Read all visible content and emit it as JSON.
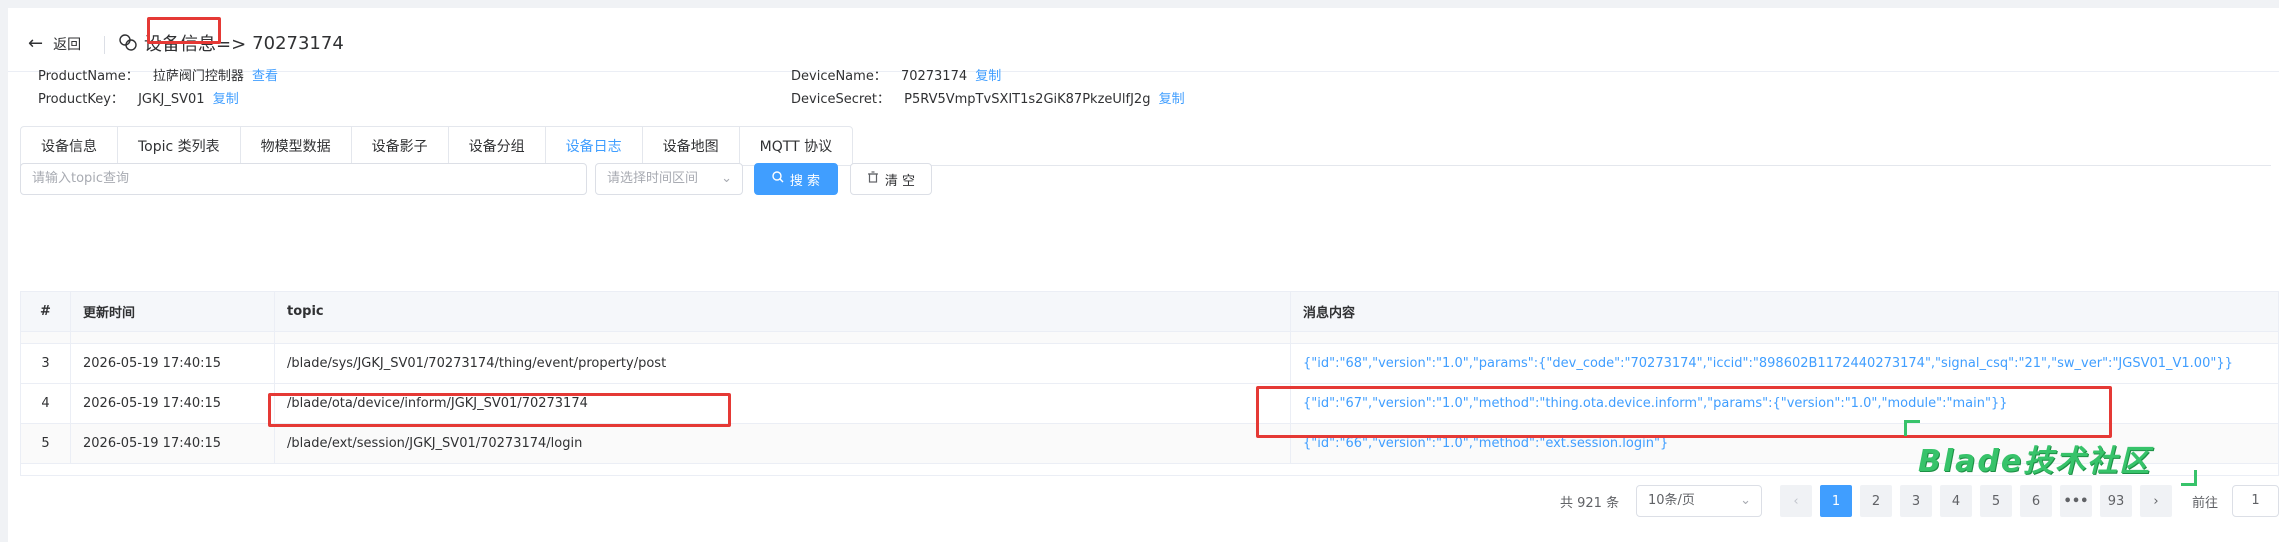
{
  "header": {
    "back_label": "返回",
    "title_prefix": "设备信息=>",
    "device_id": "70273174"
  },
  "info": {
    "product_name_key": "ProductName：",
    "product_name_value": "拉萨阀门控制器",
    "product_name_link": "查看",
    "product_key_key": "ProductKey：",
    "product_key_value": "JGKJ_SV01",
    "product_key_link": "复制",
    "device_name_key": "DeviceName：",
    "device_name_value": "70273174",
    "device_name_link": "复制",
    "device_secret_key": "DeviceSecret：",
    "device_secret_value": "P5RV5VmpTvSXIT1s2GiK87PkzeUlfJ2g",
    "device_secret_link": "复制"
  },
  "tabs": [
    {
      "label": "设备信息"
    },
    {
      "label": "Topic 类列表"
    },
    {
      "label": "物模型数据"
    },
    {
      "label": "设备影子"
    },
    {
      "label": "设备分组"
    },
    {
      "label": "设备日志",
      "active": true
    },
    {
      "label": "设备地图"
    },
    {
      "label": "MQTT 协议"
    }
  ],
  "filters": {
    "topic_placeholder": "请输入topic查询",
    "time_placeholder": "请选择时间区间",
    "search_label": "搜 索",
    "clear_label": "清 空"
  },
  "table": {
    "headers": [
      "#",
      "更新时间",
      "topic",
      "消息内容"
    ],
    "rows": [
      {
        "index": "3",
        "time": "2026-05-19 17:40:15",
        "topic": "/blade/sys/JGKJ_SV01/70273174/thing/event/property/post",
        "msg": "{\"id\":\"68\",\"version\":\"1.0\",\"params\":{\"dev_code\":\"70273174\",\"iccid\":\"898602B1172440273174\",\"signal_csq\":\"21\",\"sw_ver\":\"JGSV01_V1.00\"}}"
      },
      {
        "index": "4",
        "time": "2026-05-19 17:40:15",
        "topic": "/blade/ota/device/inform/JGKJ_SV01/70273174",
        "msg": "{\"id\":\"67\",\"version\":\"1.0\",\"method\":\"thing.ota.device.inform\",\"params\":{\"version\":\"1.0\",\"module\":\"main\"}}"
      },
      {
        "index": "5",
        "time": "2026-05-19 17:40:15",
        "topic": "/blade/ext/session/JGKJ_SV01/70273174/login",
        "msg": "{\"id\":\"66\",\"version\":\"1.0\",\"method\":\"ext.session.login\"}"
      }
    ]
  },
  "pagination": {
    "total_label": "共 921 条",
    "page_size_label": "10条/页",
    "pages": [
      "1",
      "2",
      "3",
      "4",
      "5",
      "6",
      "•••",
      "93"
    ],
    "current_page": "1",
    "prev_icon": "chevron-left-icon",
    "next_icon": "chevron-right-icon",
    "jump_label": "前往",
    "jump_value": "1"
  },
  "watermark": "Blade技术社区",
  "colors": {
    "accent": "#409eff",
    "highlight": "#e53935",
    "watermark": "#37c36a"
  }
}
